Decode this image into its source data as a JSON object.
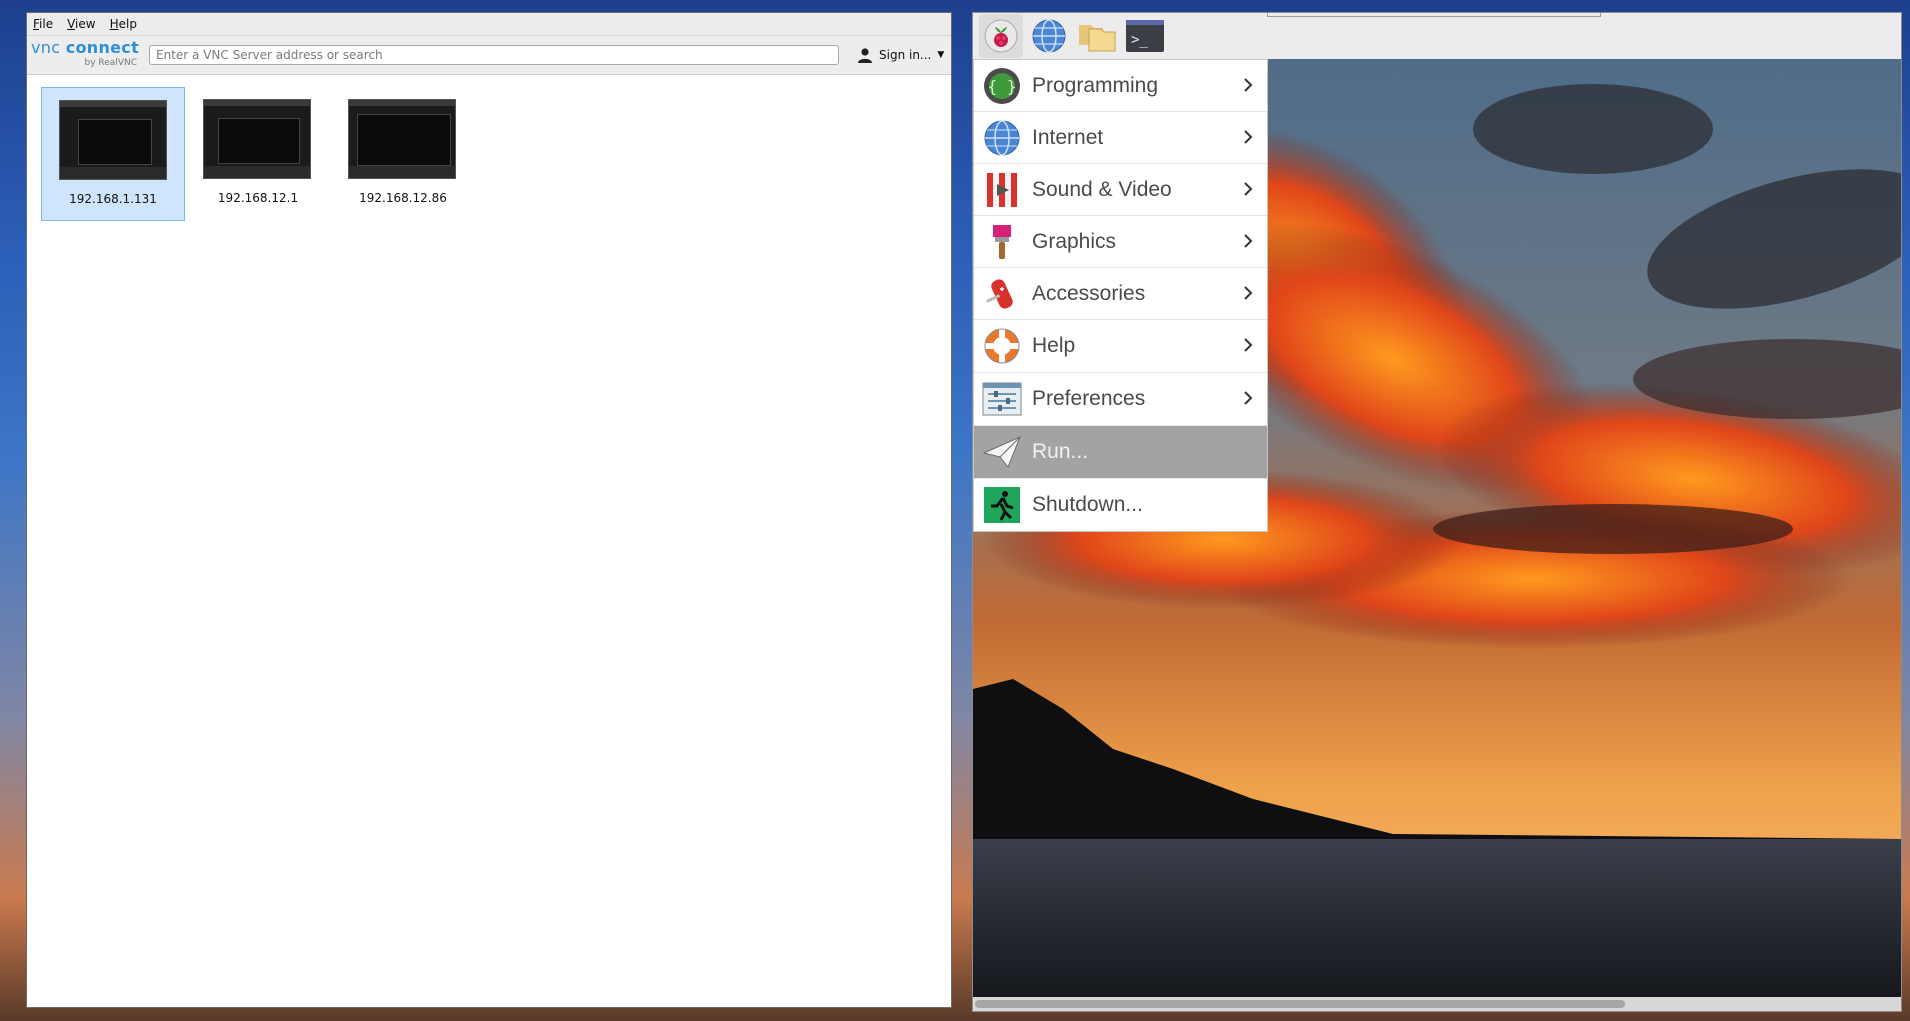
{
  "vnc_viewer": {
    "menubar": [
      {
        "label": "File",
        "accel": "F",
        "rest": "ile"
      },
      {
        "label": "View",
        "accel": "V",
        "rest": "iew"
      },
      {
        "label": "Help",
        "accel": "H",
        "rest": "elp"
      }
    ],
    "logo": {
      "line1a": "vnc",
      "line1b": "connect",
      "line2": "by RealVNC"
    },
    "search": {
      "placeholder": "Enter a VNC Server address or search",
      "value": ""
    },
    "sign_in": {
      "label": "Sign in..."
    },
    "connections": [
      {
        "address": "192.168.1.131",
        "selected": true
      },
      {
        "address": "192.168.12.1",
        "selected": false
      },
      {
        "address": "192.168.12.86",
        "selected": false
      }
    ]
  },
  "pi_desktop": {
    "panel_icons": [
      "raspberry-icon",
      "web-browser-icon",
      "file-manager-icon",
      "terminal-icon"
    ],
    "terminal_glyph": ">_",
    "menu": [
      {
        "label": "Programming",
        "icon": "programming-icon",
        "submenu": true
      },
      {
        "label": "Internet",
        "icon": "internet-icon",
        "submenu": true
      },
      {
        "label": "Sound & Video",
        "icon": "sound-video-icon",
        "submenu": true
      },
      {
        "label": "Graphics",
        "icon": "graphics-icon",
        "submenu": true
      },
      {
        "label": "Accessories",
        "icon": "accessories-icon",
        "submenu": true
      },
      {
        "label": "Help",
        "icon": "help-icon",
        "submenu": true
      },
      {
        "label": "Preferences",
        "icon": "preferences-icon",
        "submenu": true
      },
      {
        "label": "Run...",
        "icon": "run-icon",
        "submenu": false,
        "highlighted": true
      },
      {
        "label": "Shutdown...",
        "icon": "shutdown-icon",
        "submenu": false
      }
    ]
  },
  "colors": {
    "vnc_blue": "#2f8fd6",
    "selection": "#cfe5fb",
    "menu_highlight": "#a3a3a3"
  }
}
